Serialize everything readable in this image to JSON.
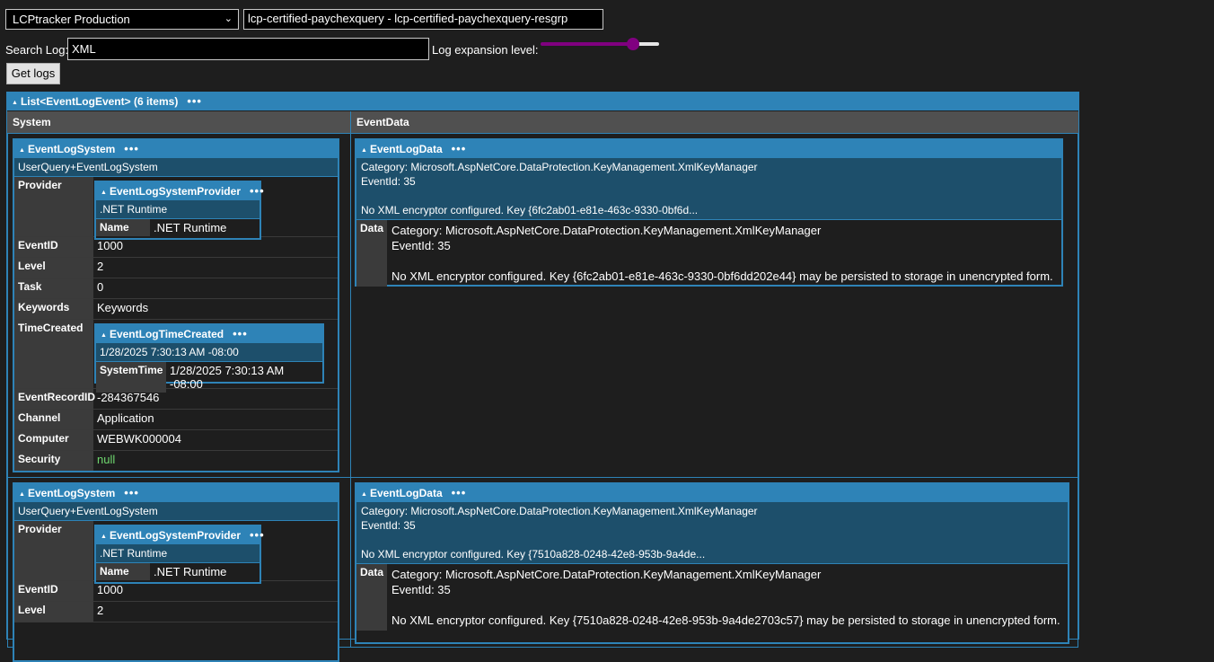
{
  "toolbar": {
    "connection": "LCPtracker Production",
    "resource": "lcp-certified-paychexquery - lcp-certified-paychexquery-resgrp",
    "search_label": "Search Log:",
    "search_value": "XML",
    "expansion_label": "Log expansion level:",
    "expansion_level": 0.78,
    "get_logs_label": "Get logs"
  },
  "results": {
    "title": "List<EventLogEvent> (6 items)",
    "columns": [
      "System",
      "EventData"
    ],
    "rows": [
      {
        "system": {
          "title": "EventLogSystem",
          "type": "UserQuery+EventLogSystem",
          "provider_key": "Provider",
          "provider": {
            "title": "EventLogSystemProvider",
            "type": ".NET Runtime",
            "name_key": "Name",
            "name_value": ".NET Runtime"
          },
          "fields": [
            {
              "key": "EventID",
              "value": "1000"
            },
            {
              "key": "Level",
              "value": "2"
            },
            {
              "key": "Task",
              "value": "0"
            },
            {
              "key": "Keywords",
              "value": "Keywords"
            }
          ],
          "time_key": "TimeCreated",
          "time": {
            "title": "EventLogTimeCreated",
            "summary": "1/28/2025 7:30:13 AM -08:00",
            "key": "SystemTime",
            "value": "1/28/2025 7:30:13 AM -08:00"
          },
          "fields2": [
            {
              "key": "EventRecordID",
              "value": "-284367546"
            },
            {
              "key": "Channel",
              "value": "Application"
            },
            {
              "key": "Computer",
              "value": "WEBWK000004"
            },
            {
              "key": "Security",
              "value": "null"
            }
          ]
        },
        "eventdata": {
          "title": "EventLogData",
          "summary": "Category: Microsoft.AspNetCore.DataProtection.KeyManagement.XmlKeyManager\nEventId: 35\n\nNo XML encryptor configured. Key {6fc2ab01-e81e-463c-9330-0bf6d...",
          "data_key": "Data",
          "data_value": "Category: Microsoft.AspNetCore.DataProtection.KeyManagement.XmlKeyManager\nEventId: 35\n\nNo XML encryptor configured. Key {6fc2ab01-e81e-463c-9330-0bf6dd202e44} may be persisted to storage in unencrypted form."
        }
      },
      {
        "system": {
          "title": "EventLogSystem",
          "type": "UserQuery+EventLogSystem",
          "provider_key": "Provider",
          "provider": {
            "title": "EventLogSystemProvider",
            "type": ".NET Runtime",
            "name_key": "Name",
            "name_value": ".NET Runtime"
          },
          "fields": [
            {
              "key": "EventID",
              "value": "1000"
            },
            {
              "key": "Level",
              "value": "2"
            }
          ]
        },
        "eventdata": {
          "title": "EventLogData",
          "summary": "Category: Microsoft.AspNetCore.DataProtection.KeyManagement.XmlKeyManager\nEventId: 35\n\nNo XML encryptor configured. Key {7510a828-0248-42e8-953b-9a4de...",
          "data_key": "Data",
          "data_value": "Category: Microsoft.AspNetCore.DataProtection.KeyManagement.XmlKeyManager\nEventId: 35\n\nNo XML encryptor configured. Key {7510a828-0248-42e8-953b-9a4de2703c57} may be persisted to storage in unencrypted form."
        }
      }
    ]
  },
  "colors": {
    "accent": "#2e83b7",
    "header_bg": "#1d4f6b",
    "null_value": "#6fd86f",
    "slider": "#800080"
  },
  "icons": {
    "expand": "collapse-triangle-icon",
    "more": "more-dots-icon"
  }
}
